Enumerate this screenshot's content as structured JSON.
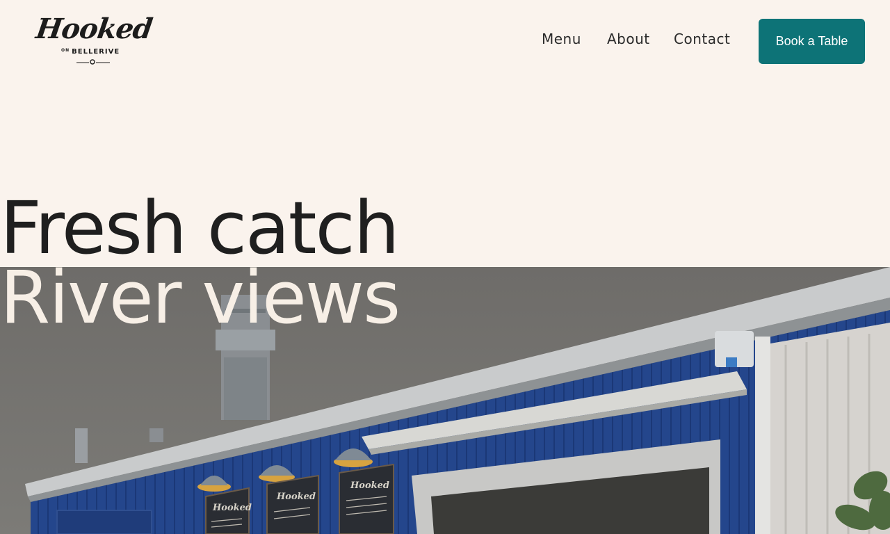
{
  "brand": {
    "logo_word": "Hooked",
    "logo_on": "ON",
    "logo_sub": "BELLERIVE"
  },
  "nav": {
    "items": [
      {
        "label": "Menu"
      },
      {
        "label": "About"
      },
      {
        "label": "Contact"
      }
    ]
  },
  "cta": {
    "label": "Book a Table"
  },
  "hero": {
    "line1": "Fresh catch",
    "line2": "River views"
  },
  "colors": {
    "background": "#faf3ed",
    "accent": "#0d7377",
    "text": "#1f1f1f"
  }
}
